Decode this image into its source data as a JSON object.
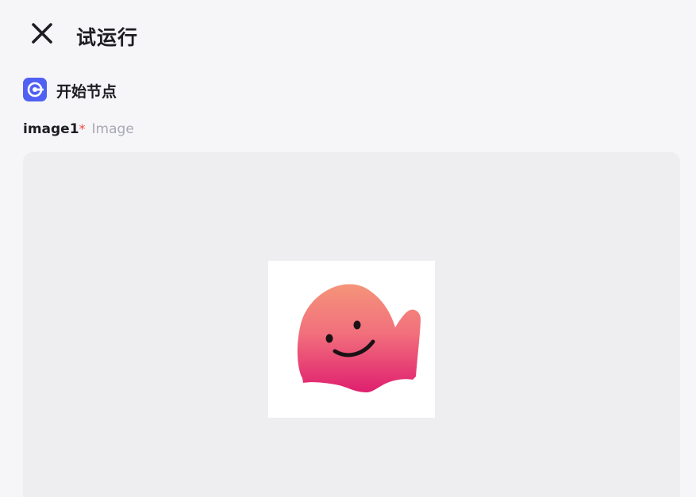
{
  "header": {
    "title": "试运行",
    "close_icon": "close-icon"
  },
  "node": {
    "title": "开始节点",
    "icon": "start-node-icon",
    "icon_color": "#5060f2"
  },
  "field": {
    "name": "image1",
    "required_mark": "*",
    "type": "Image"
  },
  "upload": {
    "preview_icon": "smiling-pink-blob-image"
  },
  "colors": {
    "background": "#f6f6f9",
    "upload_box": "#eeeef1",
    "required": "#f0483e",
    "muted_text": "#a8a9b4"
  }
}
